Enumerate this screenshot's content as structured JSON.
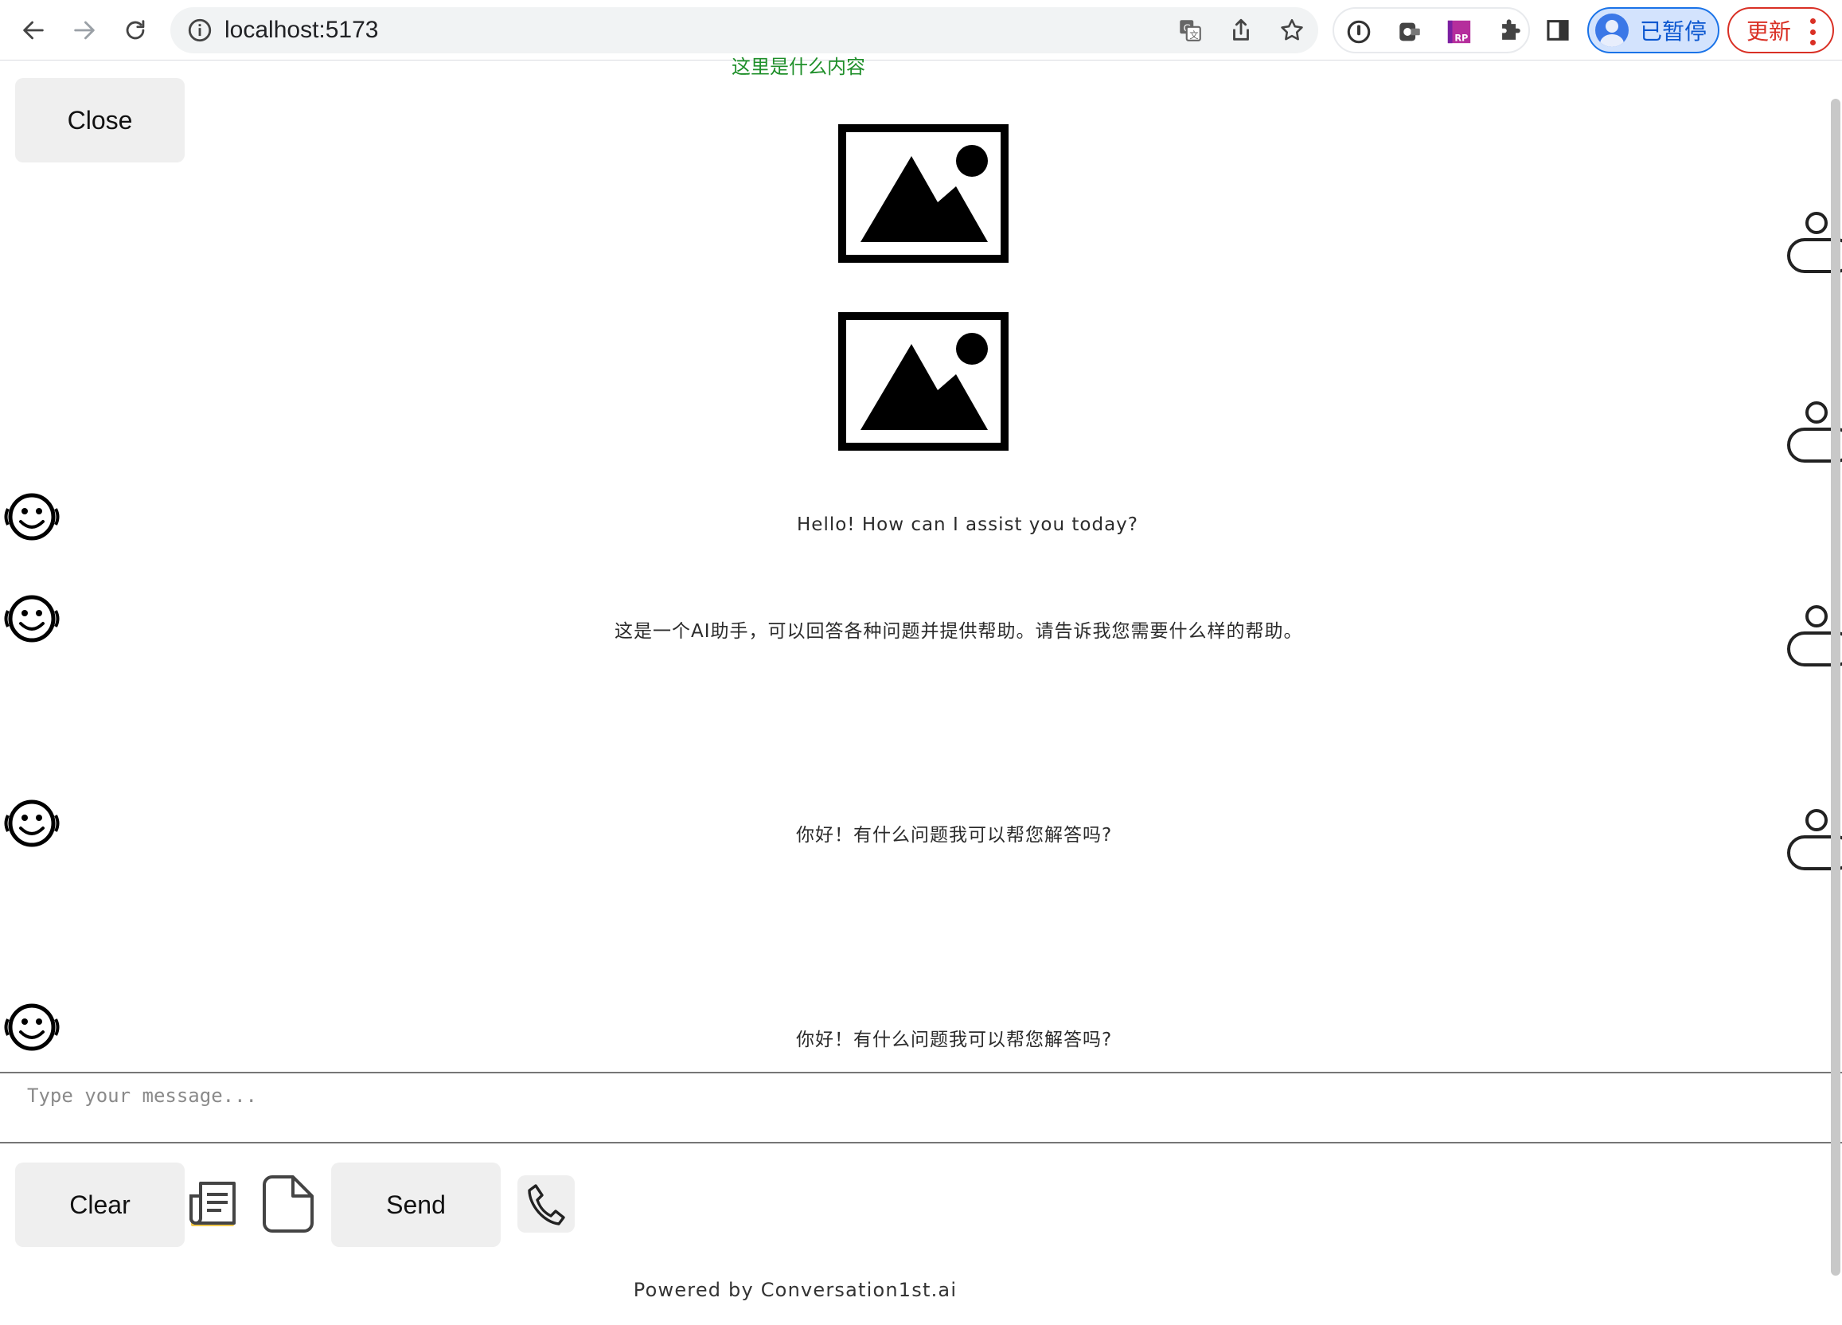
{
  "browser": {
    "url": "localhost:5173",
    "profile_label": "已暂停",
    "update_label": "更新",
    "icons": {
      "back": "arrow-left-icon",
      "forward": "arrow-right-icon",
      "reload": "reload-icon",
      "site_info": "info-icon",
      "translate": "translate-icon",
      "share": "share-icon",
      "bookmark": "star-icon",
      "extensions": "puzzle-icon",
      "side_panel": "side-panel-icon"
    }
  },
  "chat": {
    "top_caption": "这里是什么内容",
    "close_label": "Close",
    "messages": [
      {
        "role": "bot",
        "text": "Hello! How can I assist you today?"
      },
      {
        "role": "bot",
        "text": "这是一个AI助手，可以回答各种问题并提供帮助。请告诉我您需要什么样的帮助。"
      },
      {
        "role": "bot",
        "text": "你好！有什么问题我可以帮您解答吗?"
      },
      {
        "role": "bot",
        "text": "你好！有什么问题我可以帮您解答吗?"
      }
    ],
    "input": {
      "placeholder": "Type your message...",
      "value": ""
    },
    "clear_label": "Clear",
    "send_label": "Send",
    "footer": "Powered by Conversation1st.ai"
  },
  "colors": {
    "caption_green": "#1f8f2a",
    "button_bg": "#efefef",
    "update_red": "#d93025",
    "profile_blue": "#1a73e8"
  }
}
